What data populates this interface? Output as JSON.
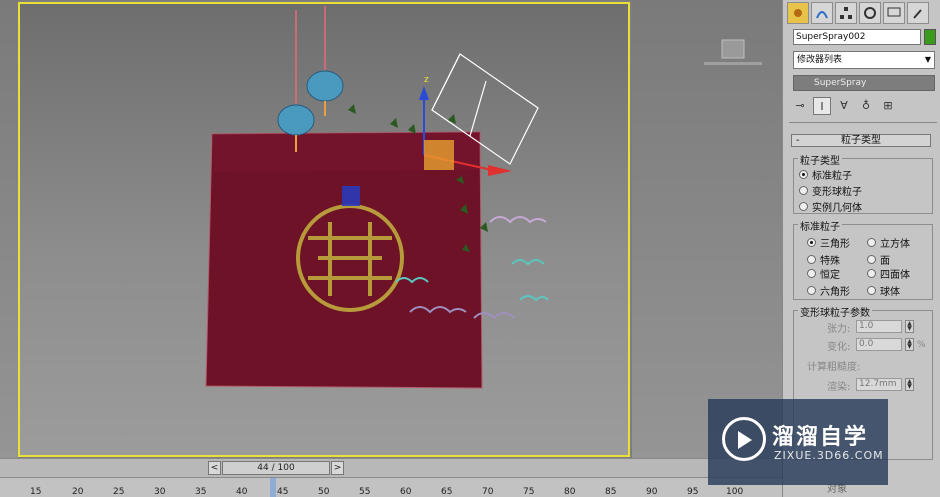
{
  "command_panel": {
    "tab_icons": [
      "sun-gear-icon",
      "curve-modify-icon",
      "hierarchy-icon",
      "motion-icon",
      "display-icon",
      "utilities-hammer-icon"
    ],
    "object_name": "SuperSpray002",
    "object_color": "#3a9a1e",
    "modifier_list_label": "修改器列表",
    "stack_item": "SuperSpray",
    "stack_tools": [
      "pin-icon",
      "show-end-result-icon",
      "make-unique-icon",
      "remove-modifier-icon",
      "configure-icon"
    ],
    "rollout_title": "粒子类型",
    "particle_type_group": {
      "title": "粒子类型",
      "options": [
        {
          "label": "标准粒子",
          "selected": true
        },
        {
          "label": "变形球粒子",
          "selected": false
        },
        {
          "label": "实例几何体",
          "selected": false
        }
      ]
    },
    "standard_particles_group": {
      "title": "标准粒子",
      "options": [
        {
          "label": "三角形",
          "selected": true
        },
        {
          "label": "立方体",
          "selected": false
        },
        {
          "label": "特殊",
          "selected": false
        },
        {
          "label": "面",
          "selected": false
        },
        {
          "label": "恒定",
          "selected": false
        },
        {
          "label": "四面体",
          "selected": false
        },
        {
          "label": "六角形",
          "selected": false
        },
        {
          "label": "球体",
          "selected": false
        }
      ]
    },
    "metaball_group": {
      "title": "变形球粒子参数",
      "tension_label": "张力:",
      "tension_value": "1.0",
      "variation_label": "变化:",
      "variation_value": "0.0",
      "variation_unit": "%",
      "coarseness_label": "计算粗糙度:",
      "render_label": "渲染:",
      "render_value": "12.7mm"
    },
    "bottom_label": "对象"
  },
  "timeline": {
    "frame_display": "44 / 100",
    "prev_label": "<",
    "next_label": ">",
    "ruler_ticks": [
      "15",
      "20",
      "25",
      "30",
      "35",
      "40",
      "45",
      "50",
      "55",
      "60",
      "65",
      "70",
      "75",
      "80",
      "85",
      "90",
      "95",
      "100"
    ]
  },
  "viewport": {
    "highlight_color": "#e8e034"
  },
  "watermark": {
    "title": "溜溜自学",
    "url": "ZIXUE.3D66.COM"
  }
}
